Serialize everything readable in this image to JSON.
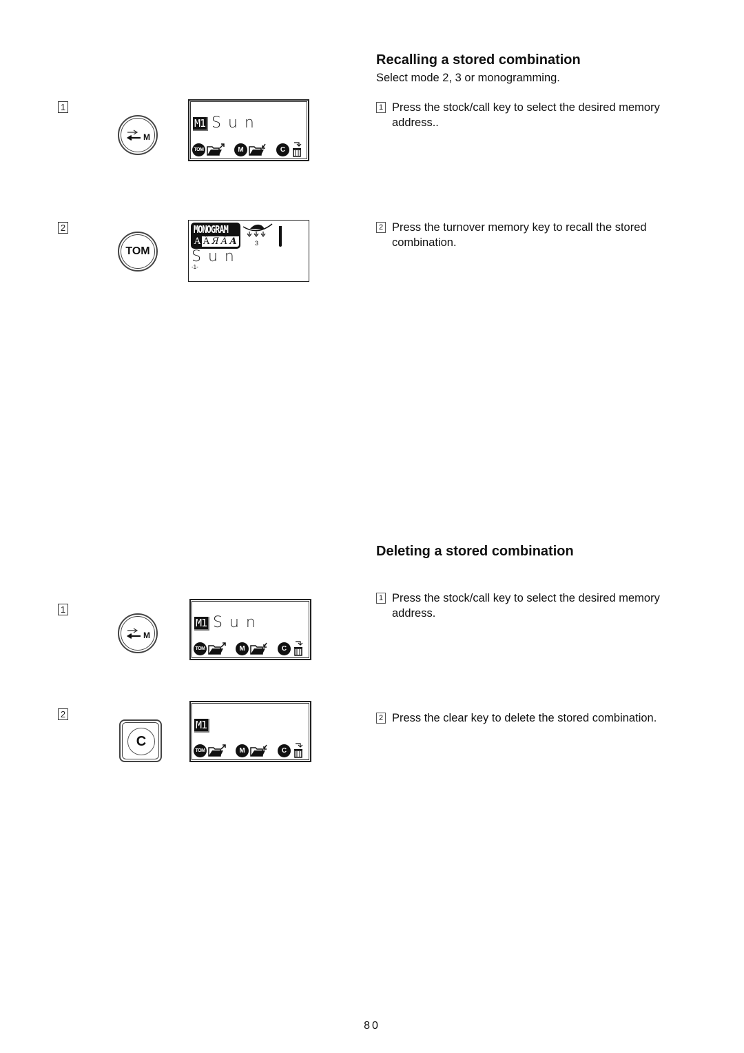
{
  "recall": {
    "title": "Recalling a stored combination",
    "intro": "Select mode 2, 3 or monogramming.",
    "steps": [
      {
        "number": "1",
        "text": "Press the stock/call key to select the desired memory address..",
        "key": {
          "type": "stock-call",
          "label": "M"
        },
        "display": {
          "memory": "M1",
          "word": "Sun",
          "icons": [
            "TOM",
            "folder-out",
            "M",
            "folder-in",
            "C",
            "trash"
          ]
        }
      },
      {
        "number": "2",
        "text": "Press the turnover memory key to recall the stored combination.",
        "key": {
          "type": "turnover-memory",
          "label": "TOM"
        },
        "display": {
          "mode_badge": "MONOGRAM",
          "font_options": [
            "A",
            "Ä",
            "Я",
            "Ä",
            "A"
          ],
          "tension_value": "3",
          "word": "Sun",
          "underline_marker": "-1-"
        }
      }
    ]
  },
  "delete": {
    "title": "Deleting a stored combination",
    "steps": [
      {
        "number": "1",
        "text": "Press the stock/call key to select the desired memory address.",
        "key": {
          "type": "stock-call",
          "label": "M"
        },
        "display": {
          "memory": "M1",
          "word": "Sun",
          "icons": [
            "TOM",
            "folder-out",
            "M",
            "folder-in",
            "C",
            "trash"
          ]
        }
      },
      {
        "number": "2",
        "text": "Press the clear key to delete the stored combination.",
        "key": {
          "type": "clear",
          "label": "C"
        },
        "display": {
          "memory": "M1",
          "word": "",
          "icons": [
            "TOM",
            "folder-out",
            "M",
            "folder-in",
            "C",
            "trash"
          ]
        }
      }
    ]
  },
  "page_number": "80"
}
